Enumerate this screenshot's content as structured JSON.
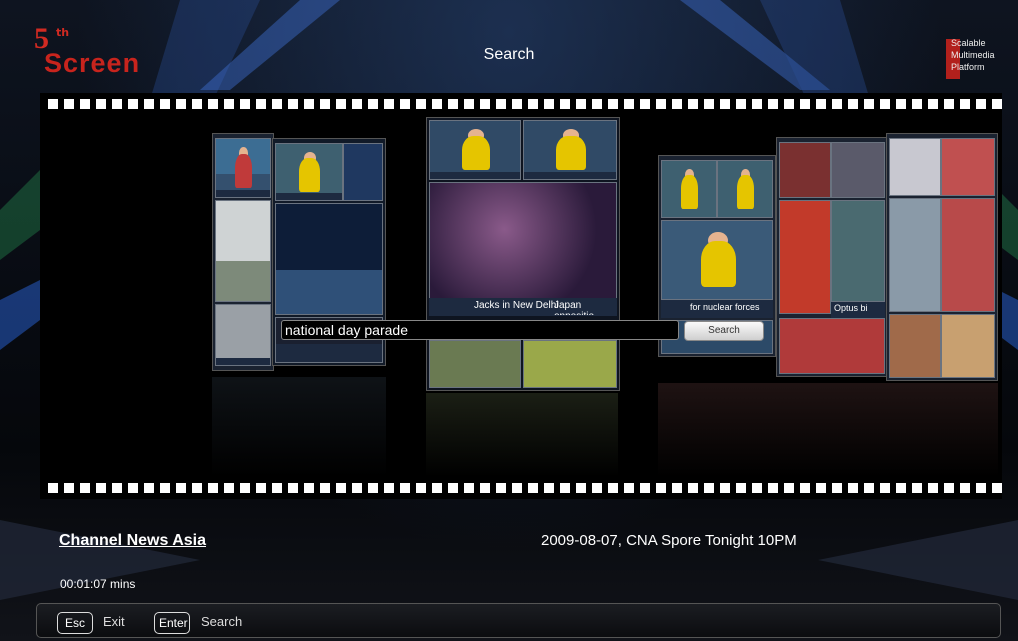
{
  "header": {
    "title": "Search",
    "left_logo": {
      "prefix": "5",
      "superscript": "th",
      "word": "Screen"
    },
    "right_logo": {
      "lines": [
        "Scalable",
        "Multimedia",
        "Platform"
      ],
      "accent": "#b2201c"
    }
  },
  "search": {
    "query": "national day parade",
    "button_label": "Search"
  },
  "wall": {
    "captions": [
      "Jacks in New Delhi",
      "Japan oppositio",
      "for nuclear forces",
      "Optus bi"
    ]
  },
  "info": {
    "channel": "Channel News Asia",
    "program": "2009-08-07, CNA Spore Tonight 10PM",
    "duration": "00:01:07 mins"
  },
  "keys": [
    {
      "key": "Esc",
      "label": "Exit"
    },
    {
      "key": "Enter",
      "label": "Search"
    }
  ],
  "colors": {
    "brand_red": "#c8241d",
    "background": "#0a0d14"
  }
}
